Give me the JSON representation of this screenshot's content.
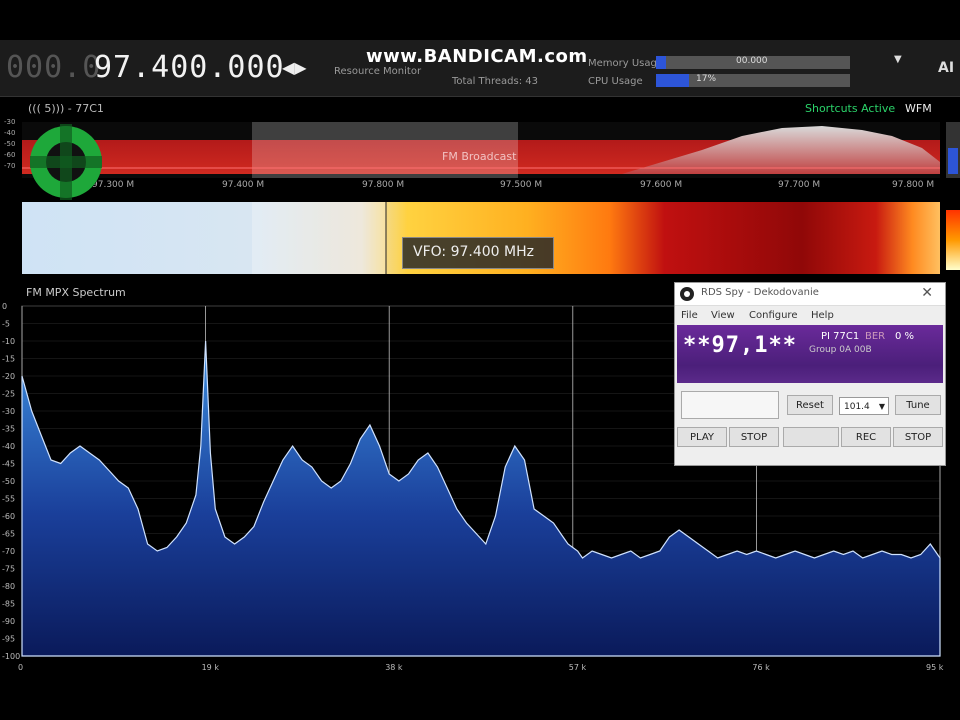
{
  "topbar": {
    "freq_faded": "000.0",
    "freq_main": "97.400.000",
    "tune_arrows": "◀▶",
    "watermark": "www.BANDICAM.com",
    "resource_monitor_label": "Resource Monitor",
    "total_threads_label": "Total Threads: 43",
    "memory_usage_label": "Memory Usage",
    "memory_usage_value": "00.000",
    "memory_usage_fraction": 0.05,
    "cpu_usage_label": "CPU Usage",
    "cpu_usage_value": "17%",
    "cpu_usage_fraction": 0.17,
    "menu_caret": "▼",
    "logo_mark": "AI"
  },
  "info_row": {
    "station": "((( 5)))  -  77C1",
    "shortcut": "Shortcuts Active",
    "mode": "WFM"
  },
  "rf_spectrum": {
    "band_label": "FM Broadcast",
    "db_ticks": [
      "-30",
      "-40",
      "-50",
      "-60",
      "-70"
    ],
    "freq_ticks": [
      "97.300 M",
      "97.400 M",
      "97.800 M",
      "97.500 M",
      "97.600 M",
      "97.700 M",
      "97.800 M"
    ]
  },
  "waterfall": {
    "vfo_label": "VFO: 97.400 MHz"
  },
  "mpx": {
    "title": "FM MPX Spectrum",
    "y_ticks": [
      "0",
      "-5",
      "-10",
      "-15",
      "-20",
      "-25",
      "-30",
      "-35",
      "-40",
      "-45",
      "-50",
      "-55",
      "-60",
      "-65",
      "-70",
      "-75",
      "-80",
      "-85",
      "-90",
      "-95",
      "-100"
    ],
    "x_ticks": [
      "0",
      "19 k",
      "38 k",
      "57 k",
      "76 k",
      "95 k"
    ]
  },
  "chart_data": {
    "type": "area",
    "title": "FM MPX Spectrum",
    "xlabel": "",
    "ylabel": "",
    "xlim": [
      0,
      95
    ],
    "ylim": [
      -100,
      0
    ],
    "grid": true,
    "x": [
      0,
      1,
      2,
      3,
      4,
      5,
      6,
      7,
      8,
      9,
      10,
      11,
      12,
      13,
      14,
      15,
      16,
      17,
      18,
      18.5,
      19,
      19.5,
      20,
      21,
      22,
      23,
      24,
      25,
      26,
      27,
      28,
      29,
      30,
      31,
      32,
      33,
      34,
      35,
      36,
      37,
      38,
      39,
      40,
      41,
      42,
      43,
      44,
      45,
      46,
      47,
      48,
      49,
      50,
      51,
      52,
      53,
      54,
      55,
      56,
      56.5,
      57,
      57.5,
      58,
      59,
      60,
      61,
      62,
      63,
      64,
      65,
      66,
      67,
      68,
      69,
      70,
      71,
      72,
      73,
      74,
      75,
      76,
      77,
      78,
      79,
      80,
      81,
      82,
      83,
      84,
      85,
      86,
      87,
      88,
      89,
      90,
      91,
      92,
      93,
      94,
      95
    ],
    "y": [
      -20,
      -30,
      -37,
      -44,
      -45,
      -42,
      -40,
      -42,
      -44,
      -47,
      -50,
      -52,
      -58,
      -68,
      -70,
      -69,
      -66,
      -62,
      -54,
      -40,
      -10,
      -42,
      -58,
      -66,
      -68,
      -66,
      -63,
      -56,
      -50,
      -44,
      -40,
      -44,
      -46,
      -50,
      -52,
      -50,
      -45,
      -38,
      -34,
      -40,
      -48,
      -50,
      -48,
      -44,
      -42,
      -46,
      -52,
      -58,
      -62,
      -65,
      -68,
      -60,
      -46,
      -40,
      -44,
      -58,
      -60,
      -62,
      -66,
      -68,
      -69,
      -70,
      -72,
      -70,
      -71,
      -72,
      -71,
      -70,
      -72,
      -71,
      -70,
      -66,
      -64,
      -66,
      -68,
      -70,
      -72,
      -71,
      -70,
      -71,
      -70,
      -71,
      -72,
      -71,
      -70,
      -71,
      -72,
      -71,
      -70,
      -71,
      -70,
      -72,
      -71,
      -70,
      -71,
      -71,
      -72,
      -71,
      -68,
      -72
    ]
  },
  "rds_window": {
    "title": "RDS Spy - Dekodovanie",
    "close": "✕",
    "menu": [
      "File",
      "View",
      "Configure",
      "Help"
    ],
    "ps": "**97,1**",
    "pi": "PI 77C1",
    "ber_label": "BER",
    "ber_value": "0 %",
    "group_info": "Group 0A  00B",
    "reset_label": "Reset",
    "select_value": "101.4",
    "tune_label": "Tune",
    "play_label": "PLAY",
    "stop_label": "STOP",
    "blank_label": "",
    "rec_label": "REC",
    "stop2_label": "STOP"
  },
  "colors": {
    "background": "#000000",
    "meter_fill": "#2d55d8",
    "rds_display": "#5b2490",
    "accent_green": "#2bd36a"
  }
}
